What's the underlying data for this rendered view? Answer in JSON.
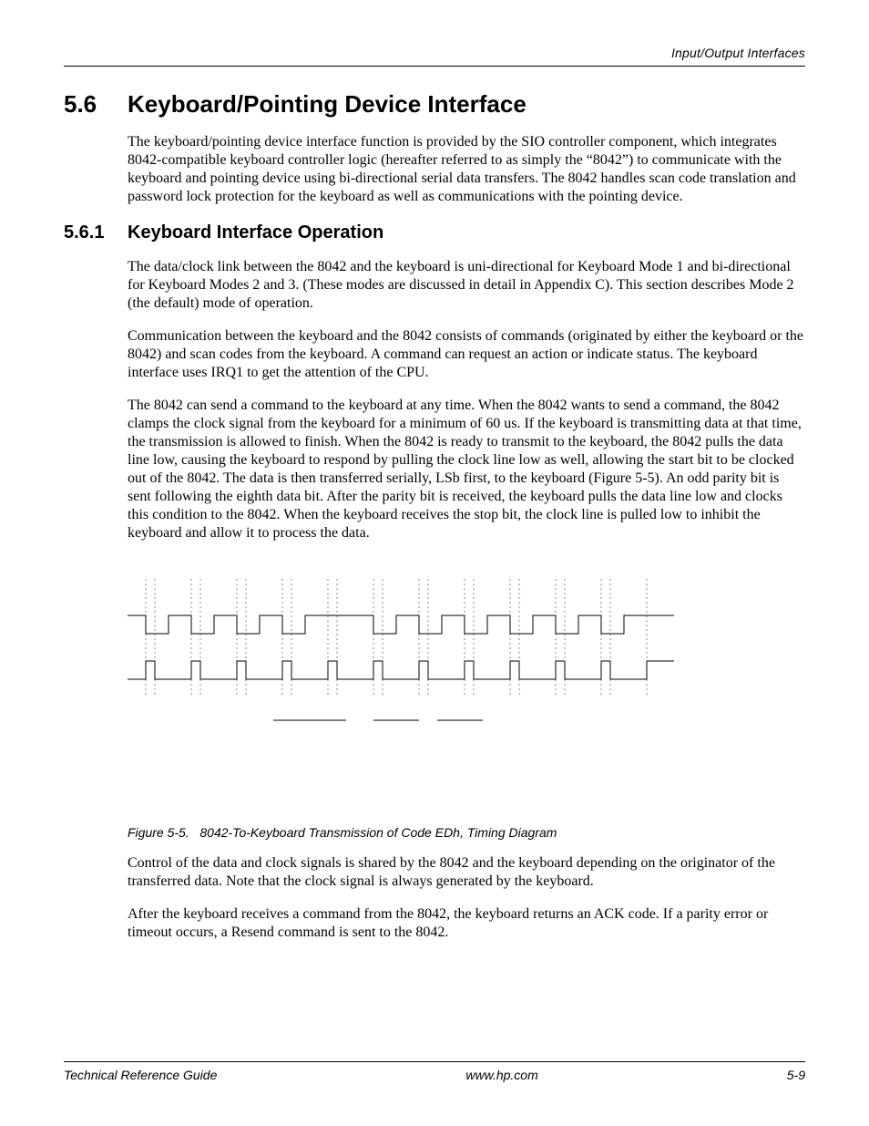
{
  "header": {
    "running_head": "Input/Output Interfaces"
  },
  "section": {
    "number": "5.6",
    "title": "Keyboard/Pointing Device Interface",
    "para1": "The keyboard/pointing device interface function is provided by the SIO controller component, which integrates 8042-compatible keyboard controller logic (hereafter referred to as simply the “8042”) to communicate with the keyboard and pointing device using bi-directional serial data transfers. The 8042 handles scan code translation and password lock protection for the keyboard as well as communications with the pointing device."
  },
  "subsection": {
    "number": "5.6.1",
    "title": "Keyboard Interface Operation",
    "para1": "The data/clock link between the 8042 and the keyboard is uni-directional for Keyboard Mode 1 and bi-directional for Keyboard Modes 2 and 3. (These modes are discussed in detail in Appendix C). This section describes Mode 2 (the default) mode of operation.",
    "para2": "Communication between the keyboard and the 8042 consists of commands (originated by either the keyboard or the 8042) and scan codes from the keyboard. A command can request an action or indicate status. The keyboard interface uses IRQ1 to get the attention of the CPU.",
    "para3": "The 8042 can send a command to the keyboard at any time. When the 8042 wants to send a command, the 8042 clamps the clock signal from the keyboard for a minimum of 60 us. If the keyboard is transmitting data at that time, the transmission is allowed to finish. When the 8042 is ready to transmit to the keyboard,  the 8042 pulls the data line low, causing the keyboard to respond by pulling the clock line low as well, allowing the start bit to be clocked out of the 8042. The data is then transferred serially, LSb first,  to the keyboard (Figure 5-5). An odd parity bit is sent following the eighth data bit. After the parity bit is received, the keyboard pulls the data line low and clocks this condition to the 8042. When the keyboard receives the stop bit, the clock line is pulled low to inhibit the keyboard and allow it to process the data."
  },
  "figure": {
    "caption_label": "Figure 5-5.",
    "caption_text": "8042-To-Keyboard Transmission of Code EDh, Timing Diagram"
  },
  "post_figure": {
    "para1": "Control of the data and clock signals is shared by the 8042 and the keyboard depending on the originator of the transferred data. Note that the clock signal is always generated by the keyboard.",
    "para2": "After the keyboard receives a command from the 8042, the keyboard returns an ACK code. If a parity error or timeout occurs, a Resend command is sent to the 8042."
  },
  "footer": {
    "left": "Technical Reference Guide",
    "center": "www.hp.com",
    "right": "5-9"
  }
}
